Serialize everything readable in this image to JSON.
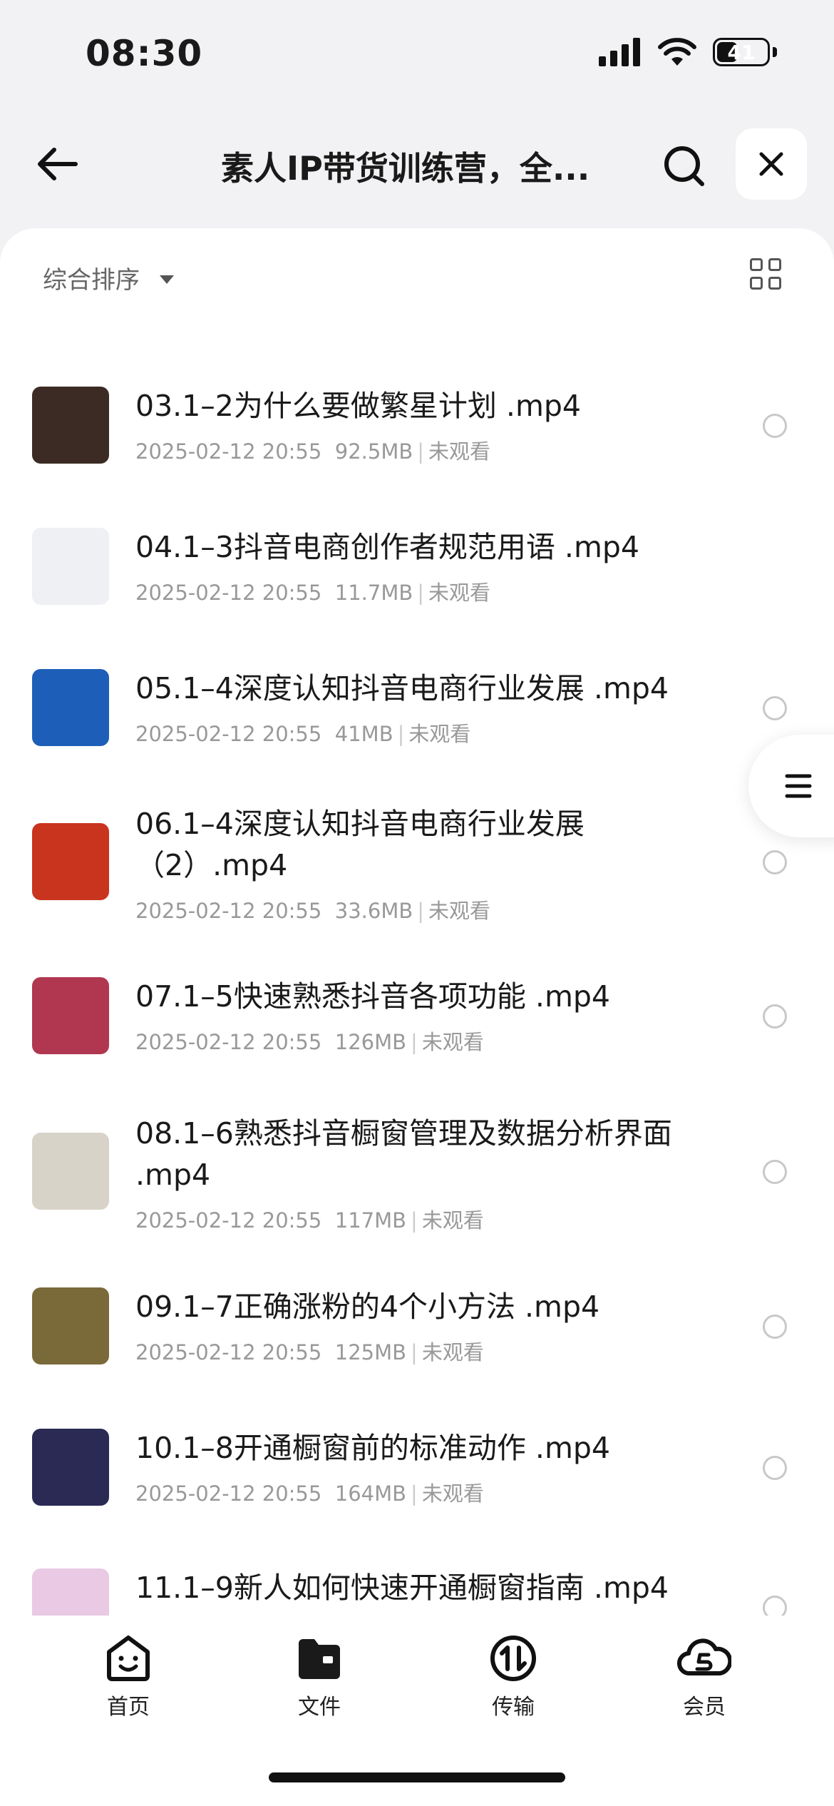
{
  "status_bar": {
    "time": "08:30",
    "battery": "41",
    "battery_level": 0.41
  },
  "header": {
    "title": "素人IP带货训练营，全...",
    "back_icon": "arrow-left-icon",
    "search_icon": "search-icon",
    "close_icon": "close-icon"
  },
  "toolbar": {
    "sort_label": "综合排序",
    "view_toggle_icon": "grid-view-icon"
  },
  "files": [
    {
      "name": "03.1–2为什么要做繁星计划 .mp4",
      "date": "2025-02-12 20:55",
      "size": "92.5MB",
      "status": "未观看",
      "thumb_color": "#3b2b24"
    },
    {
      "name": "04.1–3抖音电商创作者规范用语 .mp4",
      "date": "2025-02-12 20:55",
      "size": "11.7MB",
      "status": "未观看",
      "thumb_color": "#eef0f4"
    },
    {
      "name": "05.1–4深度认知抖音电商行业发展 .mp4",
      "date": "2025-02-12 20:55",
      "size": "41MB",
      "status": "未观看",
      "thumb_color": "#1d5fb8"
    },
    {
      "name": "06.1–4深度认知抖音电商行业发展（2）.mp4",
      "date": "2025-02-12 20:55",
      "size": "33.6MB",
      "status": "未观看",
      "thumb_color": "#c9341f"
    },
    {
      "name": "07.1–5快速熟悉抖音各项功能 .mp4",
      "date": "2025-02-12 20:55",
      "size": "126MB",
      "status": "未观看",
      "thumb_color": "#b0374f"
    },
    {
      "name": "08.1–6熟悉抖音橱窗管理及数据分析界面 .mp4",
      "date": "2025-02-12 20:55",
      "size": "117MB",
      "status": "未观看",
      "thumb_color": "#d8d3c8"
    },
    {
      "name": "09.1–7正确涨粉的4个小方法 .mp4",
      "date": "2025-02-12 20:55",
      "size": "125MB",
      "status": "未观看",
      "thumb_color": "#7a6a3a"
    },
    {
      "name": "10.1–8开通橱窗前的标准动作 .mp4",
      "date": "2025-02-12 20:55",
      "size": "164MB",
      "status": "未观看",
      "thumb_color": "#2a2a55"
    },
    {
      "name": "11.1–9新人如何快速开通橱窗指南 .mp4",
      "date": "",
      "size": "",
      "status": "",
      "thumb_color": "#e9c9e4"
    }
  ],
  "tabs": [
    {
      "label": "首页",
      "icon": "home-face-icon"
    },
    {
      "label": "文件",
      "icon": "folder-icon"
    },
    {
      "label": "传输",
      "icon": "transfer-icon"
    },
    {
      "label": "会员",
      "icon": "vip-cloud-icon"
    }
  ]
}
